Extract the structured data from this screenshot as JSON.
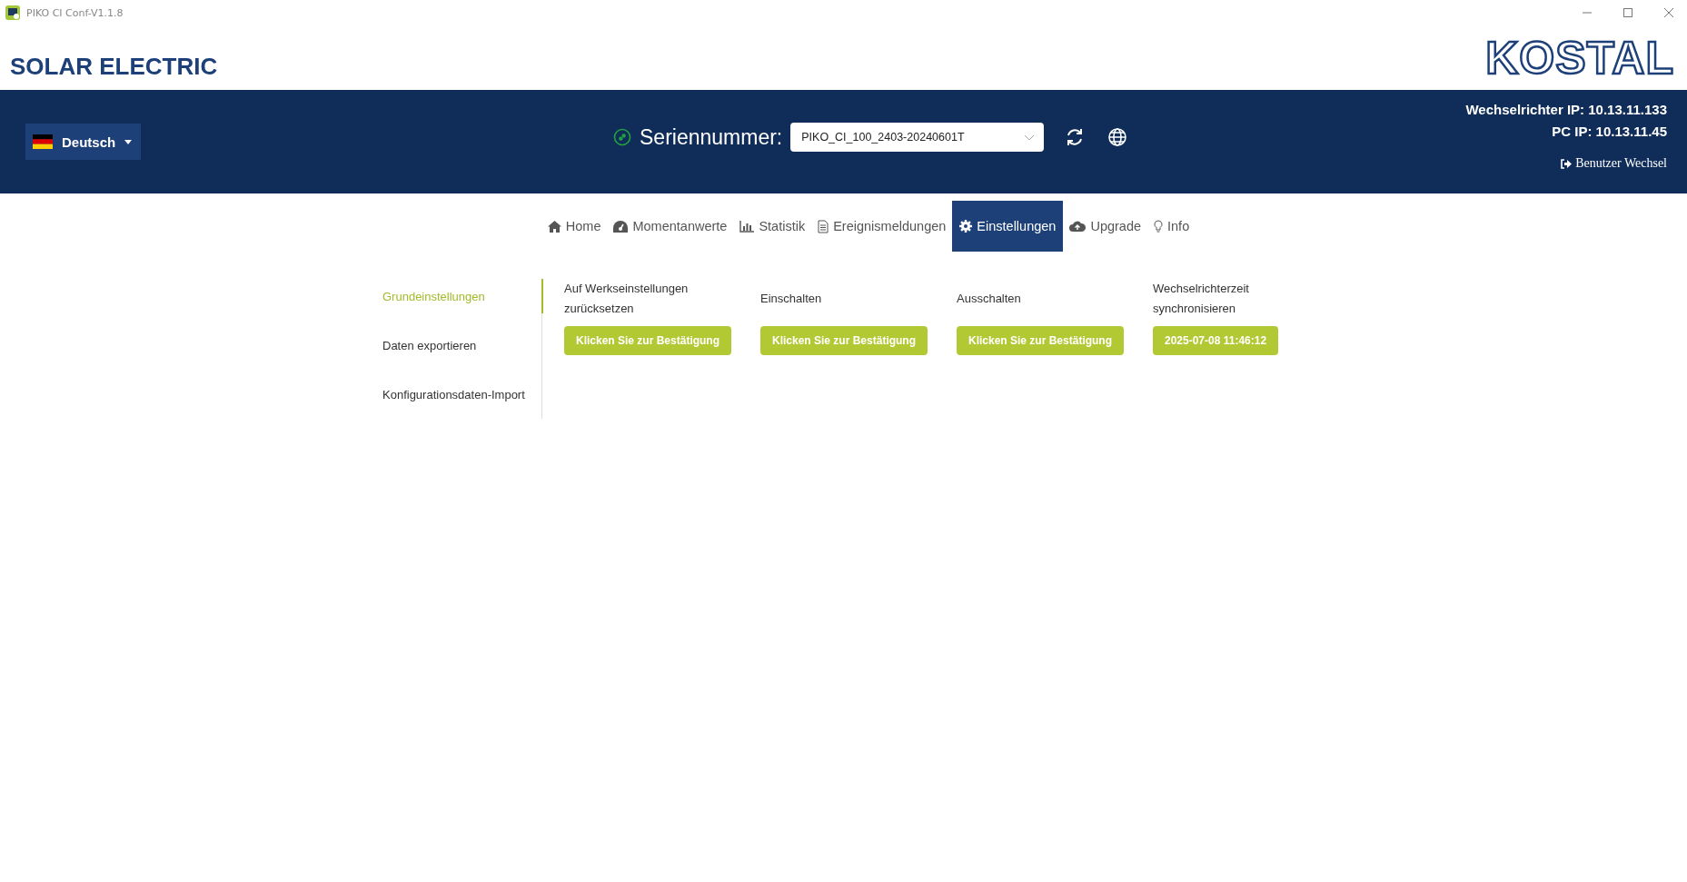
{
  "window": {
    "title": "PIKO CI Conf-V1.1.8"
  },
  "header": {
    "brand": "SOLAR ELECTRIC",
    "logo": "KOSTAL"
  },
  "toolbar": {
    "language": "Deutsch",
    "serial_label": "Seriennummer:",
    "serial_value": "PIKO_CI_100_2403-20240601T",
    "info": [
      "Wechselrichter IP: 10.13.11.133",
      "PC IP: 10.13.11.45"
    ],
    "user_switch": "Benutzer Wechsel"
  },
  "tabs": [
    {
      "label": "Home",
      "kind": "home",
      "selected": false
    },
    {
      "label": "Momentanwerte",
      "kind": "gauge",
      "selected": false
    },
    {
      "label": "Statistik",
      "kind": "chart",
      "selected": false
    },
    {
      "label": "Ereignismeldungen",
      "kind": "doc",
      "selected": false
    },
    {
      "label": "Einstellungen",
      "kind": "gear",
      "selected": true
    },
    {
      "label": "Upgrade",
      "kind": "cloud",
      "selected": false
    },
    {
      "label": "Info",
      "kind": "bulb",
      "selected": false
    }
  ],
  "sidebar": {
    "items": [
      {
        "label": "Grundeinstellungen",
        "selected": true
      },
      {
        "label": "Daten exportieren",
        "selected": false
      },
      {
        "label": "Konfigurationsdaten-Import",
        "selected": false
      }
    ]
  },
  "actions": [
    {
      "label": "Auf Werkseinstellungen zurücksetzen",
      "button": "Klicken Sie zur Bestätigung"
    },
    {
      "label": "Einschalten",
      "button": "Klicken Sie zur Bestätigung"
    },
    {
      "label": "Ausschalten",
      "button": "Klicken Sie zur Bestätigung"
    },
    {
      "label": "Wechselrichterzeit synchronisieren",
      "button": "2025-07-08 11:46:12"
    }
  ]
}
